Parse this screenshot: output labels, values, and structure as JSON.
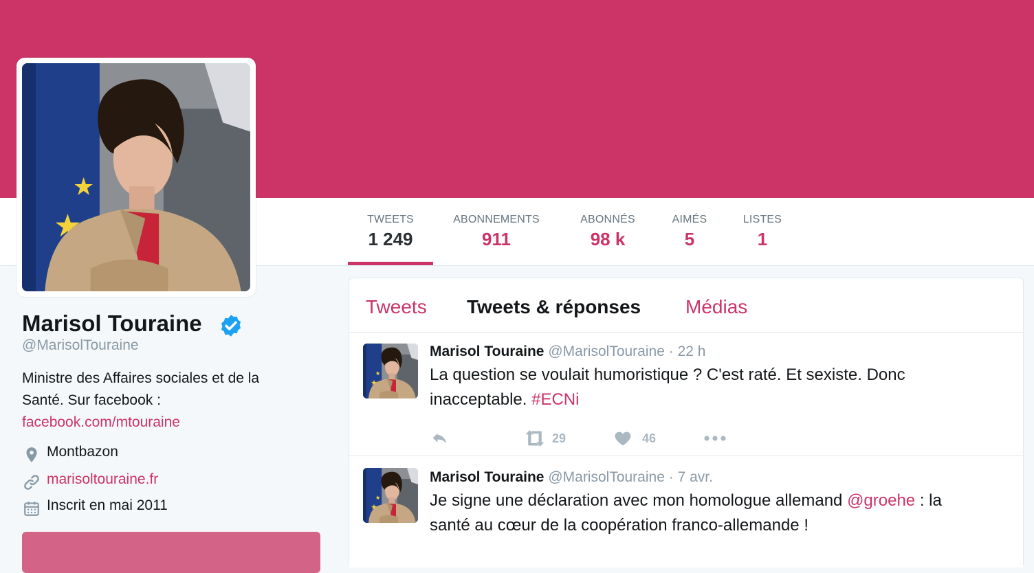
{
  "colors": {
    "theme": "#cc3366",
    "text": "#14171a",
    "muted": "#8899a6",
    "verified": "#1da1f2"
  },
  "profile": {
    "name": "Marisol Touraine",
    "handle": "@MarisolTouraine",
    "bio_line1": "Ministre des Affaires sociales et de la",
    "bio_line2": "Santé. Sur facebook :",
    "bio_link": "facebook.com/mtouraine",
    "location": "Montbazon",
    "website": "marisoltouraine.fr",
    "joined": "Inscrit en mai 2011",
    "icons": [
      "verified-badge-icon",
      "location-pin-icon",
      "link-icon",
      "calendar-icon"
    ]
  },
  "stats": [
    {
      "label": "TWEETS",
      "value": "1 249",
      "active": true
    },
    {
      "label": "ABONNEMENTS",
      "value": "911"
    },
    {
      "label": "ABONNÉS",
      "value": "98 k"
    },
    {
      "label": "AIMÉS",
      "value": "5"
    },
    {
      "label": "LISTES",
      "value": "1"
    }
  ],
  "tabs": [
    {
      "label": "Tweets"
    },
    {
      "label": "Tweets & réponses",
      "active": true
    },
    {
      "label": "Médias"
    }
  ],
  "tweets": [
    {
      "name": "Marisol Touraine",
      "handle": "@MarisolTouraine",
      "sep": " · ",
      "time": "22 h",
      "text_line1": "La question se voulait humoristique ? C'est raté. Et sexiste. Donc",
      "text_line2": "inacceptable.",
      "hashtag": "#ECNi",
      "retweets": "29",
      "likes": "46"
    },
    {
      "name": "Marisol Touraine",
      "handle": "@MarisolTouraine",
      "sep": " · ",
      "time": "7 avr.",
      "text_pre": "Je signe une déclaration avec mon homologue allemand ",
      "mention": "@groehe",
      "text_post": " : la",
      "text_line2": "santé au cœur de la coopération franco-allemande !"
    }
  ]
}
